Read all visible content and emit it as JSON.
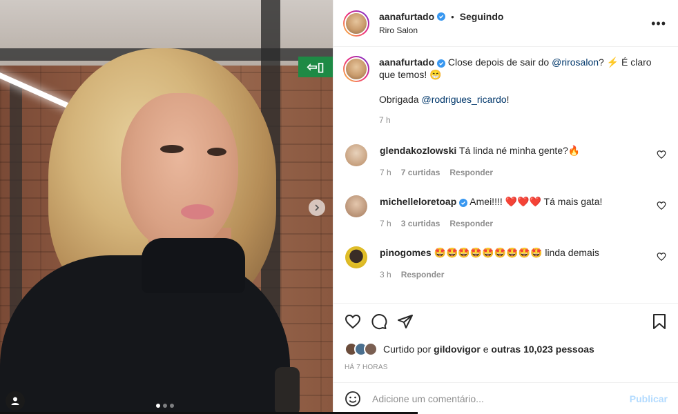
{
  "post": {
    "carousel": {
      "dot_count": 3,
      "active_index": 0
    }
  },
  "header": {
    "username": "aanafurtado",
    "separator": "•",
    "follow_status": "Seguindo",
    "location": "Riro Salon",
    "more_label": "•••"
  },
  "caption": {
    "username": "aanafurtado",
    "text_before_mention": "Close depois de sair do ",
    "mention1": "@rirosalon",
    "text_after_mention": "? ⚡ É claro que temos! 😁",
    "thanks_text": "Obrigada ",
    "mention2": "@rodrigues_ricardo",
    "thanks_end": "!",
    "time": "7 h"
  },
  "comments": [
    {
      "username": "glendakozlowski",
      "text": "Tá linda né minha gente?🔥",
      "time": "7 h",
      "likes": "7 curtidas",
      "reply": "Responder",
      "avatar_color": "#c9a27e"
    },
    {
      "username": "michelleloretoap",
      "verified": true,
      "text": "Amei!!!! ❤️❤️❤️ Tá mais gata!",
      "time": "7 h",
      "likes": "3 curtidas",
      "reply": "Responder",
      "avatar_color": "#b98d6d"
    },
    {
      "username": "pinogomes",
      "text": "🤩🤩🤩🤩🤩🤩🤩🤩🤩 linda demais",
      "time": "3 h",
      "likes": "",
      "reply": "Responder",
      "avatar_color": "#e3c22b"
    }
  ],
  "actions": {
    "liked_prefix": "Curtido por ",
    "liked_by": "gildovigor",
    "liked_middle": " e ",
    "liked_others": "outras 10,023 pessoas",
    "ago": "HÁ 7 HORAS"
  },
  "add_comment": {
    "placeholder": "Adicione um comentário...",
    "post_label": "Publicar"
  },
  "colors": {
    "verified": "#3897f0",
    "link": "#00376b",
    "muted": "#8e8e8e",
    "publish_disabled": "#b3dbff"
  }
}
